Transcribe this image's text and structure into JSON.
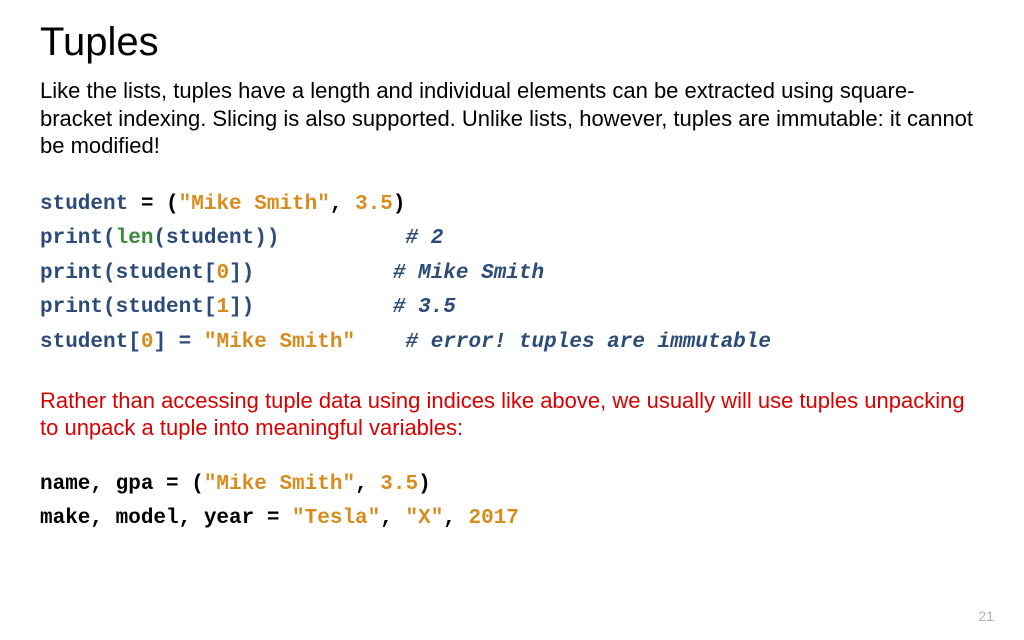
{
  "title": "Tuples",
  "intro": "Like the lists, tuples have a length and individual elements can be extracted using square-bracket indexing. Slicing is also supported.  Unlike lists, however, tuples are immutable: it cannot be modified!",
  "code1": {
    "l1": {
      "a": "student ",
      "b": "= (",
      "c": "\"Mike Smith\"",
      "d": ", ",
      "e": "3.5",
      "f": ")"
    },
    "l2": {
      "a": "print(",
      "b": "len",
      "c": "(",
      "d": "student",
      "e": "))          ",
      "f": "# 2"
    },
    "l3": {
      "a": "print(",
      "b": "student",
      "c": "[",
      "d": "0",
      "e": "])           ",
      "f": "# Mike Smith"
    },
    "l4": {
      "a": "print(",
      "b": "student",
      "c": "[",
      "d": "1",
      "e": "])           ",
      "f": "# 3.5"
    },
    "l5": {
      "a": "student",
      "b": "[",
      "c": "0",
      "d": "] = ",
      "e": "\"Mike Smith\"",
      "f": "    ",
      "g": "# error! tuples are immutable"
    }
  },
  "midtext": "Rather than accessing tuple data using indices like above, we usually will use tuples unpacking to unpack a tuple into meaningful variables:",
  "code2": {
    "l1": {
      "a": "name, gpa = (",
      "b": "\"Mike Smith\"",
      "c": ", ",
      "d": "3.5",
      "e": ")"
    },
    "l2": {
      "a": "make, model, year = ",
      "b": "\"Tesla\"",
      "c": ", ",
      "d": "\"X\"",
      "e": ", ",
      "f": "2017"
    }
  },
  "page": "21"
}
